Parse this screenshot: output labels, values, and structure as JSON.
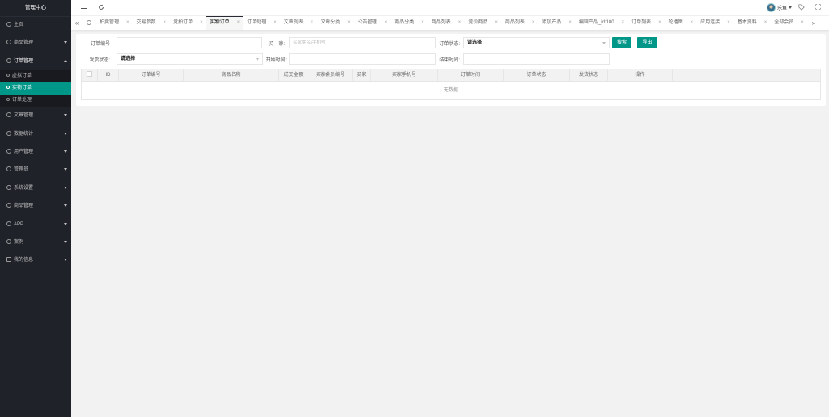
{
  "app": {
    "title": "管理中心"
  },
  "sidebar": {
    "items": [
      {
        "label": "主页"
      },
      {
        "label": "商品管理"
      },
      {
        "label": "订单管理"
      },
      {
        "label": "文章管理"
      },
      {
        "label": "数据统计"
      },
      {
        "label": "用户管理"
      },
      {
        "label": "管理员"
      },
      {
        "label": "系统设置"
      },
      {
        "label": "商品管理"
      },
      {
        "label": "APP"
      },
      {
        "label": "案例"
      },
      {
        "label": "我的信息"
      }
    ],
    "order_sub": [
      {
        "label": "虚拟订单"
      },
      {
        "label": "实物订单"
      },
      {
        "label": "订单处理"
      }
    ]
  },
  "header": {
    "user_name": "乐鱼"
  },
  "tabs": [
    "拍卖管理",
    "交易参数",
    "竞拍订单",
    "实物订单",
    "订单处理",
    "文章列表",
    "文章分类",
    "公告管理",
    "商品分类",
    "商品列表",
    "竞价商品",
    "商品列表",
    "添加产品",
    "编辑产品_id:100",
    "订单列表",
    "轮播图",
    "应用连接",
    "基本资料",
    "全部会员",
    "修改用户"
  ],
  "filters": {
    "order_no_label": "订单编号",
    "buyer_label": "买    家:",
    "buyer_placeholder": "买家姓名/手机号",
    "order_status_label": "订单状态:",
    "order_status_value": "请选择",
    "ship_status_label": "发货状态:",
    "ship_status_value": "请选择",
    "start_time_label": "开始时间:",
    "end_time_label": "结束时间:",
    "search_label": "搜索",
    "export_label": "导出"
  },
  "table": {
    "columns": [
      "ID",
      "订单编号",
      "商品名称",
      "成交金额",
      "买家会员编号",
      "买家",
      "买家手机号",
      "订单时间",
      "订单状态",
      "发货状态",
      "操作"
    ],
    "empty_text": "无数据"
  }
}
